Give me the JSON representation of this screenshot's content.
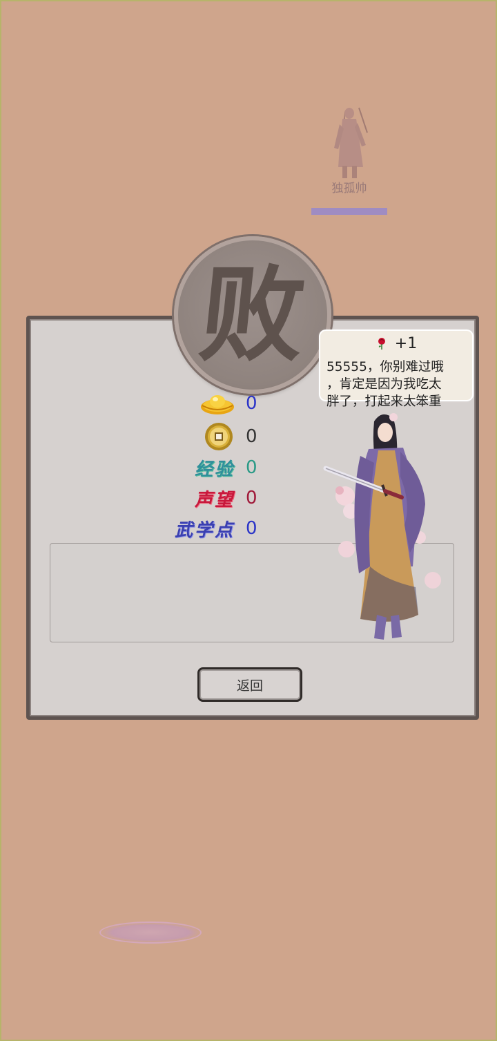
{
  "enemy": {
    "name": "独孤帅",
    "hp_fraction": 1.0
  },
  "result": {
    "seal_text": "败",
    "rewards": [
      {
        "icon": "gold-ingot-icon",
        "label": "",
        "value": "0",
        "color": "#2b34c8"
      },
      {
        "icon": "copper-coin-icon",
        "label": "",
        "value": "0",
        "color": "#333333"
      },
      {
        "icon": "",
        "label": "经验",
        "value": "0",
        "color": "#2a9a86"
      },
      {
        "icon": "",
        "label": "声望",
        "value": "0",
        "color": "#a01a3a"
      },
      {
        "icon": "",
        "label": "武学点",
        "value": "0",
        "color": "#2b34c8"
      }
    ],
    "log_text": "",
    "return_label": "返回"
  },
  "speech": {
    "gift_icon": "rose-icon",
    "gift_count": "+1",
    "text": "55555，你别难过哦\n，肯定是因为我吃太\n胖了，打起来太笨重"
  },
  "colors": {
    "background": "#cfa58c",
    "panel": "#d6d1cf",
    "panel_border": "#5e5350",
    "exp_label": "#2f8f9b",
    "fame_label": "#c8183c",
    "skill_label": "#3a3fb0"
  }
}
